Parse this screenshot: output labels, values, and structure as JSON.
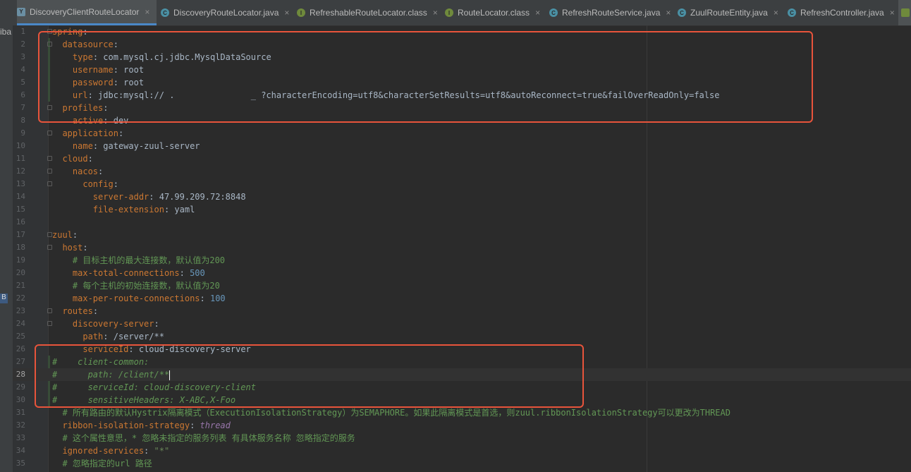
{
  "tabs": [
    {
      "label": "DiscoveryClientRouteLocator",
      "icon": "yaml-file-icon",
      "active": true
    },
    {
      "label": "DiscoveryRouteLocator.java",
      "icon": "java-class-icon"
    },
    {
      "label": "RefreshableRouteLocator.class",
      "icon": "class-file-icon"
    },
    {
      "label": "RouteLocator.class",
      "icon": "class-file-icon"
    },
    {
      "label": "RefreshRouteService.java",
      "icon": "java-class-icon"
    },
    {
      "label": "ZuulRouteEntity.java",
      "icon": "java-class-icon"
    },
    {
      "label": "RefreshController.java",
      "icon": "java-class-icon"
    }
  ],
  "left_panel": {
    "text": "iba",
    "badge": "B"
  },
  "colors": {
    "key": "#cc7832",
    "value": "#a9b7c6",
    "comment": "#629755",
    "number": "#6897bb",
    "highlight_box": "#e8543b"
  },
  "code_lines": [
    {
      "n": "1",
      "key": "spring",
      "sep": ":",
      "val": ""
    },
    {
      "n": "2",
      "indent": "  ",
      "key": "datasource",
      "sep": ":",
      "val": ""
    },
    {
      "n": "3",
      "indent": "    ",
      "key": "type",
      "sep": ": ",
      "val": "com.mysql.cj.jdbc.MysqlDataSource"
    },
    {
      "n": "4",
      "indent": "    ",
      "key": "username",
      "sep": ": ",
      "val": "root"
    },
    {
      "n": "5",
      "indent": "    ",
      "key": "password",
      "sep": ": ",
      "val": "root"
    },
    {
      "n": "6",
      "indent": "    ",
      "key": "url",
      "sep": ": ",
      "val": "jdbc:mysql:// .               _ ?characterEncoding=utf8&characterSetResults=utf8&autoReconnect=true&failOverReadOnly=false"
    },
    {
      "n": "7",
      "indent": "  ",
      "key": "profiles",
      "sep": ":",
      "val": ""
    },
    {
      "n": "8",
      "indent": "    ",
      "key": "active",
      "sep": ": ",
      "val": "dev"
    },
    {
      "n": "9",
      "indent": "  ",
      "key": "application",
      "sep": ":",
      "val": ""
    },
    {
      "n": "10",
      "indent": "    ",
      "key": "name",
      "sep": ": ",
      "val": "gateway-zuul-server"
    },
    {
      "n": "11",
      "indent": "  ",
      "key": "cloud",
      "sep": ":",
      "val": ""
    },
    {
      "n": "12",
      "indent": "    ",
      "key": "nacos",
      "sep": ":",
      "val": ""
    },
    {
      "n": "13",
      "indent": "      ",
      "key": "config",
      "sep": ":",
      "val": ""
    },
    {
      "n": "14",
      "indent": "        ",
      "key": "server-addr",
      "sep": ": ",
      "val": "47.99.209.72:8848"
    },
    {
      "n": "15",
      "indent": "        ",
      "key": "file-extension",
      "sep": ": ",
      "val": "yaml"
    },
    {
      "n": "16",
      "blank": true
    },
    {
      "n": "17",
      "key": "zuul",
      "sep": ":",
      "val": ""
    },
    {
      "n": "18",
      "indent": "  ",
      "key": "host",
      "sep": ":",
      "val": ""
    },
    {
      "n": "19",
      "indent": "    ",
      "comment": "# 目标主机的最大连接数，默认值为200"
    },
    {
      "n": "20",
      "indent": "    ",
      "key": "max-total-connections",
      "sep": ": ",
      "val": "500",
      "numval": true
    },
    {
      "n": "21",
      "indent": "    ",
      "comment": "# 每个主机的初始连接数，默认值为20"
    },
    {
      "n": "22",
      "indent": "    ",
      "key": "max-per-route-connections",
      "sep": ": ",
      "val": "100",
      "numval": true
    },
    {
      "n": "23",
      "indent": "  ",
      "key": "routes",
      "sep": ":",
      "val": ""
    },
    {
      "n": "24",
      "indent": "    ",
      "key": "discovery-server",
      "sep": ":",
      "val": ""
    },
    {
      "n": "25",
      "indent": "      ",
      "key": "path",
      "sep": ": ",
      "val": "/server/**"
    },
    {
      "n": "26",
      "indent": "      ",
      "key": "serviceId",
      "sep": ": ",
      "val": "cloud-discovery-server"
    },
    {
      "n": "27",
      "comment": "#    client-common:",
      "ital": true
    },
    {
      "n": "28",
      "comment": "#      path: /client/**",
      "ital": true,
      "current": true
    },
    {
      "n": "29",
      "comment": "#      serviceId: cloud-discovery-client",
      "ital": true
    },
    {
      "n": "30",
      "comment": "#      sensitiveHeaders: X-ABC,X-Foo",
      "ital": true
    },
    {
      "n": "31",
      "indent": "  ",
      "comment": "# 所有路由的默认Hystrix隔离模式（ExecutionIsolationStrategy）为SEMAPHORE。如果此隔离模式是首选，则zuul.ribbonIsolationStrategy可以更改为THREAD"
    },
    {
      "n": "32",
      "indent": "  ",
      "key": "ribbon-isolation-strategy",
      "sep": ": ",
      "val": "thread",
      "kwval": true
    },
    {
      "n": "33",
      "indent": "  ",
      "comment": "# 这个属性意思，* 忽略未指定的服务列表 有具体服务名称 忽略指定的服务"
    },
    {
      "n": "34",
      "indent": "  ",
      "key": "ignored-services",
      "sep": ": ",
      "val": "\"*\"",
      "strval": true
    },
    {
      "n": "35",
      "indent": "  ",
      "comment": "# 忽略指定的url 路径"
    }
  ]
}
